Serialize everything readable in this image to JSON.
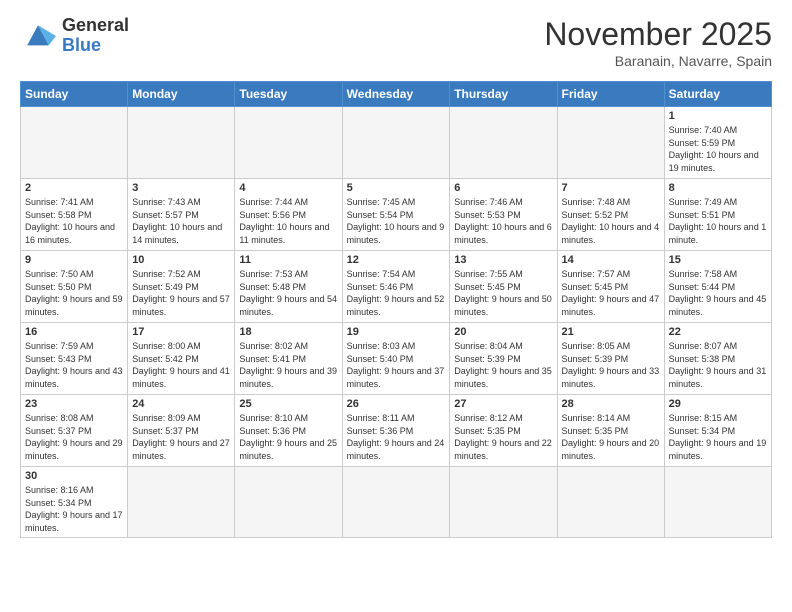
{
  "header": {
    "logo_line1": "General",
    "logo_line2": "Blue",
    "month": "November 2025",
    "location": "Baranain, Navarre, Spain"
  },
  "weekdays": [
    "Sunday",
    "Monday",
    "Tuesday",
    "Wednesday",
    "Thursday",
    "Friday",
    "Saturday"
  ],
  "weeks": [
    [
      {
        "day": "",
        "info": ""
      },
      {
        "day": "",
        "info": ""
      },
      {
        "day": "",
        "info": ""
      },
      {
        "day": "",
        "info": ""
      },
      {
        "day": "",
        "info": ""
      },
      {
        "day": "",
        "info": ""
      },
      {
        "day": "1",
        "info": "Sunrise: 7:40 AM\nSunset: 5:59 PM\nDaylight: 10 hours and 19 minutes."
      }
    ],
    [
      {
        "day": "2",
        "info": "Sunrise: 7:41 AM\nSunset: 5:58 PM\nDaylight: 10 hours and 16 minutes."
      },
      {
        "day": "3",
        "info": "Sunrise: 7:43 AM\nSunset: 5:57 PM\nDaylight: 10 hours and 14 minutes."
      },
      {
        "day": "4",
        "info": "Sunrise: 7:44 AM\nSunset: 5:56 PM\nDaylight: 10 hours and 11 minutes."
      },
      {
        "day": "5",
        "info": "Sunrise: 7:45 AM\nSunset: 5:54 PM\nDaylight: 10 hours and 9 minutes."
      },
      {
        "day": "6",
        "info": "Sunrise: 7:46 AM\nSunset: 5:53 PM\nDaylight: 10 hours and 6 minutes."
      },
      {
        "day": "7",
        "info": "Sunrise: 7:48 AM\nSunset: 5:52 PM\nDaylight: 10 hours and 4 minutes."
      },
      {
        "day": "8",
        "info": "Sunrise: 7:49 AM\nSunset: 5:51 PM\nDaylight: 10 hours and 1 minute."
      }
    ],
    [
      {
        "day": "9",
        "info": "Sunrise: 7:50 AM\nSunset: 5:50 PM\nDaylight: 9 hours and 59 minutes."
      },
      {
        "day": "10",
        "info": "Sunrise: 7:52 AM\nSunset: 5:49 PM\nDaylight: 9 hours and 57 minutes."
      },
      {
        "day": "11",
        "info": "Sunrise: 7:53 AM\nSunset: 5:48 PM\nDaylight: 9 hours and 54 minutes."
      },
      {
        "day": "12",
        "info": "Sunrise: 7:54 AM\nSunset: 5:46 PM\nDaylight: 9 hours and 52 minutes."
      },
      {
        "day": "13",
        "info": "Sunrise: 7:55 AM\nSunset: 5:45 PM\nDaylight: 9 hours and 50 minutes."
      },
      {
        "day": "14",
        "info": "Sunrise: 7:57 AM\nSunset: 5:45 PM\nDaylight: 9 hours and 47 minutes."
      },
      {
        "day": "15",
        "info": "Sunrise: 7:58 AM\nSunset: 5:44 PM\nDaylight: 9 hours and 45 minutes."
      }
    ],
    [
      {
        "day": "16",
        "info": "Sunrise: 7:59 AM\nSunset: 5:43 PM\nDaylight: 9 hours and 43 minutes."
      },
      {
        "day": "17",
        "info": "Sunrise: 8:00 AM\nSunset: 5:42 PM\nDaylight: 9 hours and 41 minutes."
      },
      {
        "day": "18",
        "info": "Sunrise: 8:02 AM\nSunset: 5:41 PM\nDaylight: 9 hours and 39 minutes."
      },
      {
        "day": "19",
        "info": "Sunrise: 8:03 AM\nSunset: 5:40 PM\nDaylight: 9 hours and 37 minutes."
      },
      {
        "day": "20",
        "info": "Sunrise: 8:04 AM\nSunset: 5:39 PM\nDaylight: 9 hours and 35 minutes."
      },
      {
        "day": "21",
        "info": "Sunrise: 8:05 AM\nSunset: 5:39 PM\nDaylight: 9 hours and 33 minutes."
      },
      {
        "day": "22",
        "info": "Sunrise: 8:07 AM\nSunset: 5:38 PM\nDaylight: 9 hours and 31 minutes."
      }
    ],
    [
      {
        "day": "23",
        "info": "Sunrise: 8:08 AM\nSunset: 5:37 PM\nDaylight: 9 hours and 29 minutes."
      },
      {
        "day": "24",
        "info": "Sunrise: 8:09 AM\nSunset: 5:37 PM\nDaylight: 9 hours and 27 minutes."
      },
      {
        "day": "25",
        "info": "Sunrise: 8:10 AM\nSunset: 5:36 PM\nDaylight: 9 hours and 25 minutes."
      },
      {
        "day": "26",
        "info": "Sunrise: 8:11 AM\nSunset: 5:36 PM\nDaylight: 9 hours and 24 minutes."
      },
      {
        "day": "27",
        "info": "Sunrise: 8:12 AM\nSunset: 5:35 PM\nDaylight: 9 hours and 22 minutes."
      },
      {
        "day": "28",
        "info": "Sunrise: 8:14 AM\nSunset: 5:35 PM\nDaylight: 9 hours and 20 minutes."
      },
      {
        "day": "29",
        "info": "Sunrise: 8:15 AM\nSunset: 5:34 PM\nDaylight: 9 hours and 19 minutes."
      }
    ],
    [
      {
        "day": "30",
        "info": "Sunrise: 8:16 AM\nSunset: 5:34 PM\nDaylight: 9 hours and 17 minutes."
      },
      {
        "day": "",
        "info": ""
      },
      {
        "day": "",
        "info": ""
      },
      {
        "day": "",
        "info": ""
      },
      {
        "day": "",
        "info": ""
      },
      {
        "day": "",
        "info": ""
      },
      {
        "day": "",
        "info": ""
      }
    ]
  ]
}
